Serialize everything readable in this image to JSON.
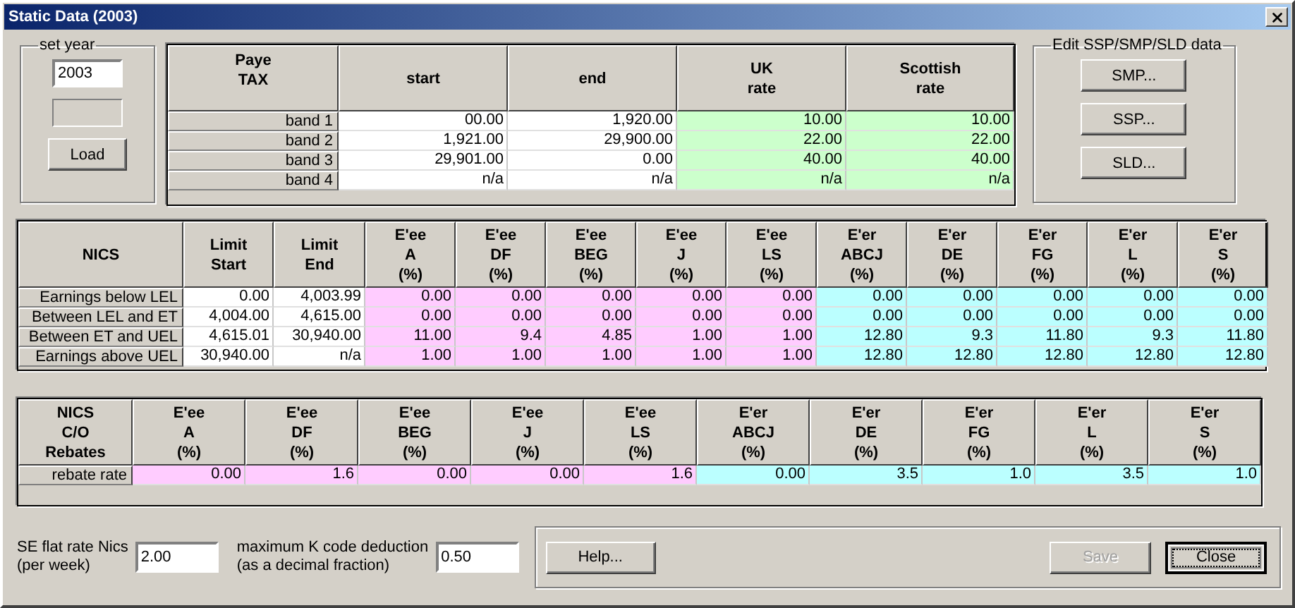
{
  "window": {
    "title": "Static Data (2003)"
  },
  "year_group": {
    "label": "set year",
    "year": "2003",
    "load_button": "Load"
  },
  "paye_table": {
    "corner": "Paye\nTAX",
    "columns": [
      {
        "header": "start",
        "color": "#ffffff"
      },
      {
        "header": "end",
        "color": "#ffffff"
      },
      {
        "header": "UK\nrate",
        "color": "#ccffcc"
      },
      {
        "header": "Scottish\nrate",
        "color": "#ccffcc"
      }
    ],
    "rows": [
      {
        "label": "band 1",
        "cells": [
          "00.00",
          "1,920.00",
          "10.00",
          "10.00"
        ]
      },
      {
        "label": "band 2",
        "cells": [
          "1,921.00",
          "29,900.00",
          "22.00",
          "22.00"
        ]
      },
      {
        "label": "band 3",
        "cells": [
          "29,901.00",
          "0.00",
          "40.00",
          "40.00"
        ]
      },
      {
        "label": "band 4",
        "cells": [
          "n/a",
          "n/a",
          "n/a",
          "n/a"
        ]
      }
    ]
  },
  "edit_group": {
    "label": "Edit SSP/SMP/SLD data",
    "buttons": [
      "SMP...",
      "SSP...",
      "SLD..."
    ]
  },
  "nics_table": {
    "corner": "NICS",
    "columns": [
      {
        "header": "Limit\nStart",
        "color": "#ffffff"
      },
      {
        "header": "Limit\nEnd",
        "color": "#ffffff"
      },
      {
        "header": "E'ee\nA\n(%)",
        "color": "#ffccff"
      },
      {
        "header": "E'ee\nDF\n(%)",
        "color": "#ffccff"
      },
      {
        "header": "E'ee\nBEG\n(%)",
        "color": "#ffccff"
      },
      {
        "header": "E'ee\nJ\n(%)",
        "color": "#ffccff"
      },
      {
        "header": "E'ee\nLS\n(%)",
        "color": "#ffccff"
      },
      {
        "header": "E'er\nABCJ\n(%)",
        "color": "#bbffff"
      },
      {
        "header": "E'er\nDE\n(%)",
        "color": "#bbffff"
      },
      {
        "header": "E'er\nFG\n(%)",
        "color": "#bbffff"
      },
      {
        "header": "E'er\nL\n(%)",
        "color": "#bbffff"
      },
      {
        "header": "E'er\nS\n(%)",
        "color": "#bbffff"
      }
    ],
    "rows": [
      {
        "label": "Earnings below LEL",
        "cells": [
          "0.00",
          "4,003.99",
          "0.00",
          "0.00",
          "0.00",
          "0.00",
          "0.00",
          "0.00",
          "0.00",
          "0.00",
          "0.00",
          "0.00"
        ]
      },
      {
        "label": "Between LEL and ET",
        "cells": [
          "4,004.00",
          "4,615.00",
          "0.00",
          "0.00",
          "0.00",
          "0.00",
          "0.00",
          "0.00",
          "0.00",
          "0.00",
          "0.00",
          "0.00"
        ]
      },
      {
        "label": "Between ET and UEL",
        "cells": [
          "4,615.01",
          "30,940.00",
          "11.00",
          "9.4",
          "4.85",
          "1.00",
          "1.00",
          "12.80",
          "9.3",
          "11.80",
          "9.3",
          "11.80"
        ]
      },
      {
        "label": "Earnings above UEL",
        "cells": [
          "30,940.00",
          "n/a",
          "1.00",
          "1.00",
          "1.00",
          "1.00",
          "1.00",
          "12.80",
          "12.80",
          "12.80",
          "12.80",
          "12.80"
        ]
      }
    ]
  },
  "rebates_table": {
    "corner": "NICS\nC/O\nRebates",
    "columns": [
      {
        "header": "E'ee\nA\n(%)",
        "color": "#ffccff"
      },
      {
        "header": "E'ee\nDF\n(%)",
        "color": "#ffccff"
      },
      {
        "header": "E'ee\nBEG\n(%)",
        "color": "#ffccff"
      },
      {
        "header": "E'ee\nJ\n(%)",
        "color": "#ffccff"
      },
      {
        "header": "E'ee\nLS\n(%)",
        "color": "#ffccff"
      },
      {
        "header": "E'er\nABCJ\n(%)",
        "color": "#bbffff"
      },
      {
        "header": "E'er\nDE\n(%)",
        "color": "#bbffff"
      },
      {
        "header": "E'er\nFG\n(%)",
        "color": "#bbffff"
      },
      {
        "header": "E'er\nL\n(%)",
        "color": "#bbffff"
      },
      {
        "header": "E'er\nS\n(%)",
        "color": "#bbffff"
      }
    ],
    "rows": [
      {
        "label": "rebate rate",
        "cells": [
          "0.00",
          "1.6",
          "0.00",
          "0.00",
          "1.6",
          "0.00",
          "3.5",
          "1.0",
          "3.5",
          "1.0"
        ]
      }
    ]
  },
  "fields": [
    {
      "label": "SE flat rate Nics\n(per week)",
      "value": "2.00"
    },
    {
      "label": "maximum K code deduction\n(as a decimal fraction)",
      "value": "0.50"
    }
  ],
  "buttons": [
    {
      "label": "Help...",
      "disabled": false,
      "default": false
    },
    {
      "label": "Save",
      "disabled": true,
      "default": false
    },
    {
      "label": "Close",
      "disabled": false,
      "default": true
    }
  ]
}
